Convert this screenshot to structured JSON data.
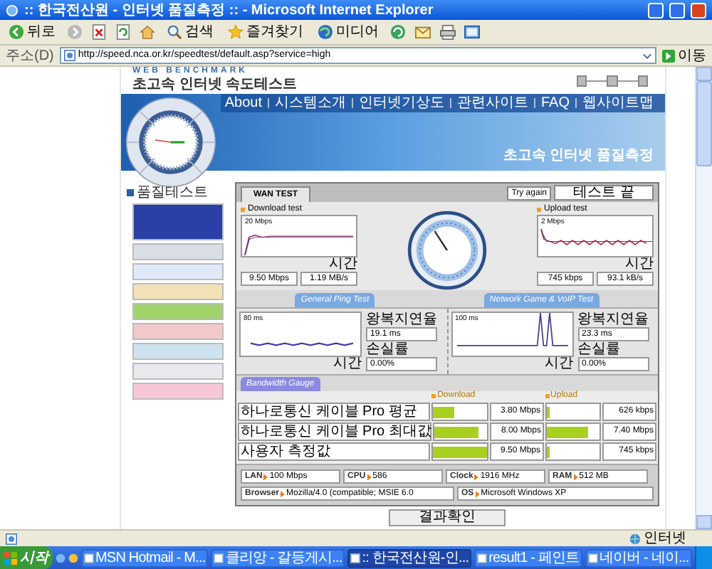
{
  "window": {
    "title": ":: 한국전산원 - 인터넷 품질측정 :: - Microsoft Internet Explorer"
  },
  "toolbar": {
    "buttons": [
      {
        "label": "뒤로"
      },
      {
        "label": "검색"
      },
      {
        "label": "즐겨찾기"
      },
      {
        "label": "미디어"
      }
    ]
  },
  "address": {
    "label": "주소(D)",
    "url": "http://speed.nca.or.kr/speedtest/default.asp?service=high",
    "go": "이동"
  },
  "page": {
    "brand": "WEB BENCHMARK",
    "site_title": "초고속 인터넷 속도테스트",
    "nav": [
      "About",
      "시스템소개",
      "인터넷기상도",
      "관련사이트",
      "FAQ",
      "웹사이트맵"
    ],
    "banner_title": "초고속 인터넷 품질측정",
    "sidebar": {
      "heading": "품질테스트",
      "banners": [
        {
          "color": "#2a3fa8"
        },
        {
          "color": "#d9dde6"
        },
        {
          "color": "#dfe9f7"
        },
        {
          "color": "#f3e2b8"
        },
        {
          "color": "#9fd36a"
        },
        {
          "color": "#f2c9c9"
        },
        {
          "color": "#cfe3ee"
        },
        {
          "color": "#e9e9ee"
        },
        {
          "color": "#f7c6d8"
        }
      ]
    },
    "test": {
      "tab": "WAN TEST",
      "try_again": "Try again",
      "status": "테스트 끝",
      "download": {
        "title": "Download test",
        "scale": "20 Mbps",
        "axis": "시간",
        "readings": [
          "9.50 Mbps",
          "1.19 MB/s"
        ]
      },
      "upload": {
        "title": "Upload test",
        "scale": "2 Mbps",
        "axis": "시간",
        "readings": [
          "745 kbps",
          "93.1 kB/s"
        ]
      },
      "ping_buttons": [
        "General Ping Test",
        "Network Game & VoIP Test"
      ],
      "ping": [
        {
          "scale": "80 ms",
          "axis": "시간",
          "delay_label": "왕복지연율",
          "delay": "19.1 ms",
          "loss_label": "손실률",
          "loss": "0.00%"
        },
        {
          "scale": "100 ms",
          "axis": "시간",
          "delay_label": "왕복지연율",
          "delay": "23.3 ms",
          "loss_label": "손실률",
          "loss": "0.00%"
        }
      ],
      "gauge_button": "Bandwidth Gauge",
      "columns": [
        "Download",
        "Upload"
      ],
      "rows": [
        {
          "label": "하나로통신 케이블 Pro 평균",
          "download": {
            "level": 0.4,
            "reading": "3.80 Mbps"
          },
          "upload": {
            "level": 0.06,
            "reading": "626 kbps"
          }
        },
        {
          "label": "하나로통신 케이블 Pro 최대값",
          "download": {
            "level": 0.84,
            "reading": "8.00 Mbps"
          },
          "upload": {
            "level": 0.78,
            "reading": "7.40 Mbps"
          }
        },
        {
          "label": "사용자 측정값",
          "download": {
            "level": 1,
            "reading": "9.50 Mbps"
          },
          "upload": {
            "level": 0.07,
            "reading": "745 kbps"
          }
        }
      ],
      "system": [
        {
          "label": "LAN",
          "value": "100 Mbps"
        },
        {
          "label": "CPU",
          "value": "586"
        },
        {
          "label": "Clock",
          "value": "1916 MHz"
        },
        {
          "label": "RAM",
          "value": "512 MB"
        },
        {
          "label": "Browser",
          "value": "Mozilla/4.0 (compatible; MSIE 6.0"
        },
        {
          "label": "OS",
          "value": "Microsoft Windows XP"
        }
      ],
      "result_button": "결과확인"
    }
  },
  "status_bar": {
    "zone": "인터넷"
  },
  "taskbar": {
    "start": "시작",
    "tasks": [
      {
        "label": "MSN Hotmail - M...",
        "selected": false
      },
      {
        "label": "클리앙 - 갈등게시...",
        "selected": false
      },
      {
        "label": ":: 한국전산원-인...",
        "selected": true
      },
      {
        "label": "result1 - 페인트",
        "selected": false
      },
      {
        "label": "네이버 - 네이...",
        "selected": false
      }
    ]
  }
}
